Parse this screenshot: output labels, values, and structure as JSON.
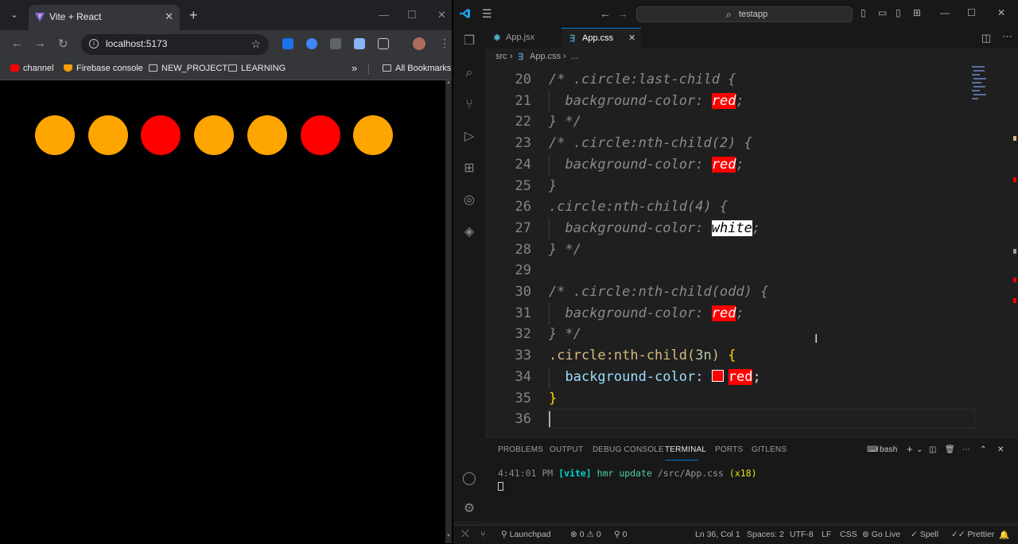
{
  "browser": {
    "tab_title": "Vite + React",
    "url": "localhost:5173",
    "bookmarks": [
      "channel",
      "Firebase console",
      "NEW_PROJECT",
      "LEARNING"
    ],
    "all_bookmarks": "All Bookmarks",
    "circles": [
      "#ffa500",
      "#ffa500",
      "#ff0000",
      "#ffa500",
      "#ffa500",
      "#ff0000",
      "#ffa500"
    ]
  },
  "vscode": {
    "search": "testapp",
    "tabs": [
      {
        "icon": "react-icon",
        "label": "App.jsx",
        "active": false
      },
      {
        "icon": "css-icon",
        "label": "App.css",
        "active": true
      }
    ],
    "breadcrumb": [
      "src",
      "App.css",
      "..."
    ],
    "code": [
      {
        "n": "20",
        "text": "/* .circle:last-child {"
      },
      {
        "n": "21",
        "prop": "background-color: ",
        "val": "red",
        "end": ";"
      },
      {
        "n": "22",
        "text": "} */"
      },
      {
        "n": "23",
        "text": "/* .circle:nth-child(2) {"
      },
      {
        "n": "24",
        "prop": "background-color: ",
        "val": "red",
        "end": ";"
      },
      {
        "n": "25",
        "text": "}"
      },
      {
        "n": "26",
        "text": ".circle:nth-child(4) {"
      },
      {
        "n": "27",
        "prop": "background-color: ",
        "val": "white",
        "end": ";"
      },
      {
        "n": "28",
        "text": "} */"
      },
      {
        "n": "29",
        "text": ""
      },
      {
        "n": "30",
        "text": "/* .circle:nth-child(odd) {"
      },
      {
        "n": "31",
        "prop": "background-color: ",
        "val": "red",
        "end": ";"
      },
      {
        "n": "32",
        "text": "} */"
      },
      {
        "n": "33",
        "sel": ".circle:nth-child(",
        "arg": "3n",
        "close": ") ",
        "brace": "{"
      },
      {
        "n": "34",
        "prop": "background-color: ",
        "val": "red",
        "end": ";"
      },
      {
        "n": "35",
        "brace": "}"
      },
      {
        "n": "36"
      }
    ],
    "panel_tabs": [
      "PROBLEMS",
      "OUTPUT",
      "DEBUG CONSOLE",
      "TERMINAL",
      "PORTS",
      "GITLENS"
    ],
    "terminal_shell": "bash",
    "terminal_line": {
      "time": "4:41:01 PM",
      "vite": "[vite]",
      "msg": "hmr update",
      "file": "/src/App.css",
      "count": "(x18)"
    },
    "status": {
      "launchpad": "Launchpad",
      "errors": "0",
      "warnings": "0",
      "ports": "0",
      "position": "Ln 36, Col 1",
      "spaces": "Spaces: 2",
      "encoding": "UTF-8",
      "eol": "LF",
      "language": "CSS",
      "golive": "Go Live",
      "spell": "Spell",
      "prettier": "Prettier"
    }
  }
}
